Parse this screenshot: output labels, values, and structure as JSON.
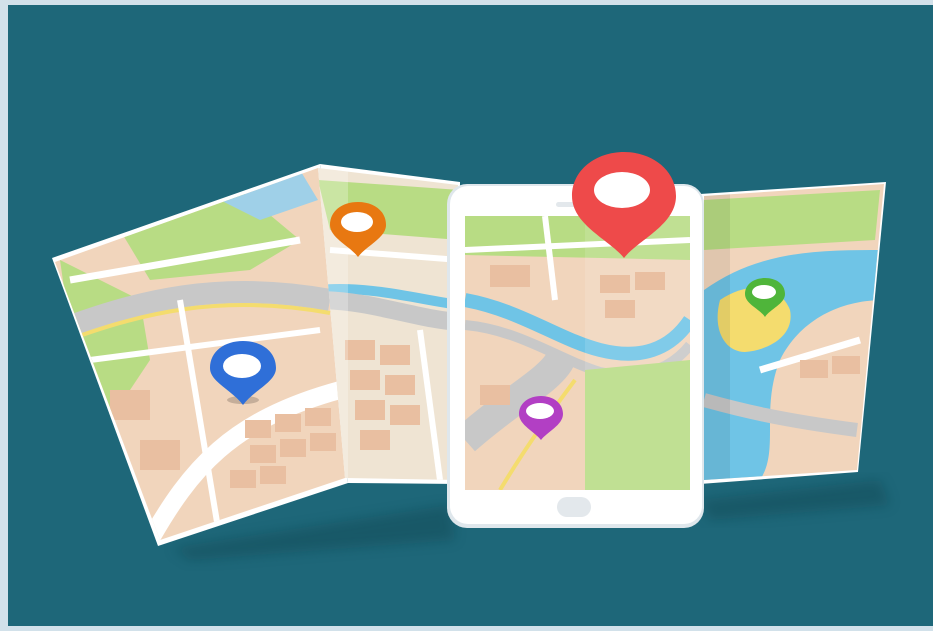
{
  "scene": {
    "subject": "folded-paper-map-with-smartphone",
    "colors": {
      "background": "#1e6779",
      "frame": "#d2e1ea",
      "paper": "#ffffff",
      "land_tan": "#f1d5bc",
      "block_tan": "#e9bfa1",
      "park_green": "#b8dc84",
      "water_blue": "#6fc4e6",
      "road_grey": "#c8c8c8",
      "road_yellow": "#f4dc6e"
    },
    "pins": [
      {
        "name": "blue-pin",
        "color": "#2f6fd8"
      },
      {
        "name": "orange-pin",
        "color": "#e87811"
      },
      {
        "name": "red-pin",
        "color": "#ee4a4a"
      },
      {
        "name": "purple-pin",
        "color": "#b23fc4"
      },
      {
        "name": "green-pin",
        "color": "#4fb53a"
      }
    ]
  }
}
